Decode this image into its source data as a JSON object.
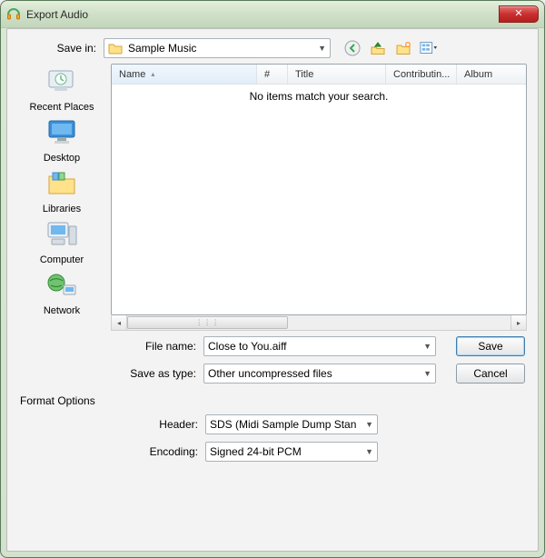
{
  "window": {
    "title": "Export Audio"
  },
  "saveIn": {
    "label": "Save in:",
    "value": "Sample Music"
  },
  "places": [
    {
      "id": "recent",
      "label": "Recent Places"
    },
    {
      "id": "desktop",
      "label": "Desktop"
    },
    {
      "id": "libraries",
      "label": "Libraries"
    },
    {
      "id": "computer",
      "label": "Computer"
    },
    {
      "id": "network",
      "label": "Network"
    }
  ],
  "listview": {
    "columns": {
      "name": "Name",
      "num": "#",
      "title": "Title",
      "contrib": "Contributin...",
      "album": "Album"
    },
    "emptyText": "No items match your search."
  },
  "fileName": {
    "label": "File name:",
    "value": "Close to You.aiff"
  },
  "saveType": {
    "label": "Save as type:",
    "value": "Other uncompressed files"
  },
  "buttons": {
    "save": "Save",
    "cancel": "Cancel"
  },
  "format": {
    "title": "Format Options",
    "header": {
      "label": "Header:",
      "value": "SDS (Midi Sample Dump Stan"
    },
    "encoding": {
      "label": "Encoding:",
      "value": "Signed 24-bit PCM"
    }
  }
}
